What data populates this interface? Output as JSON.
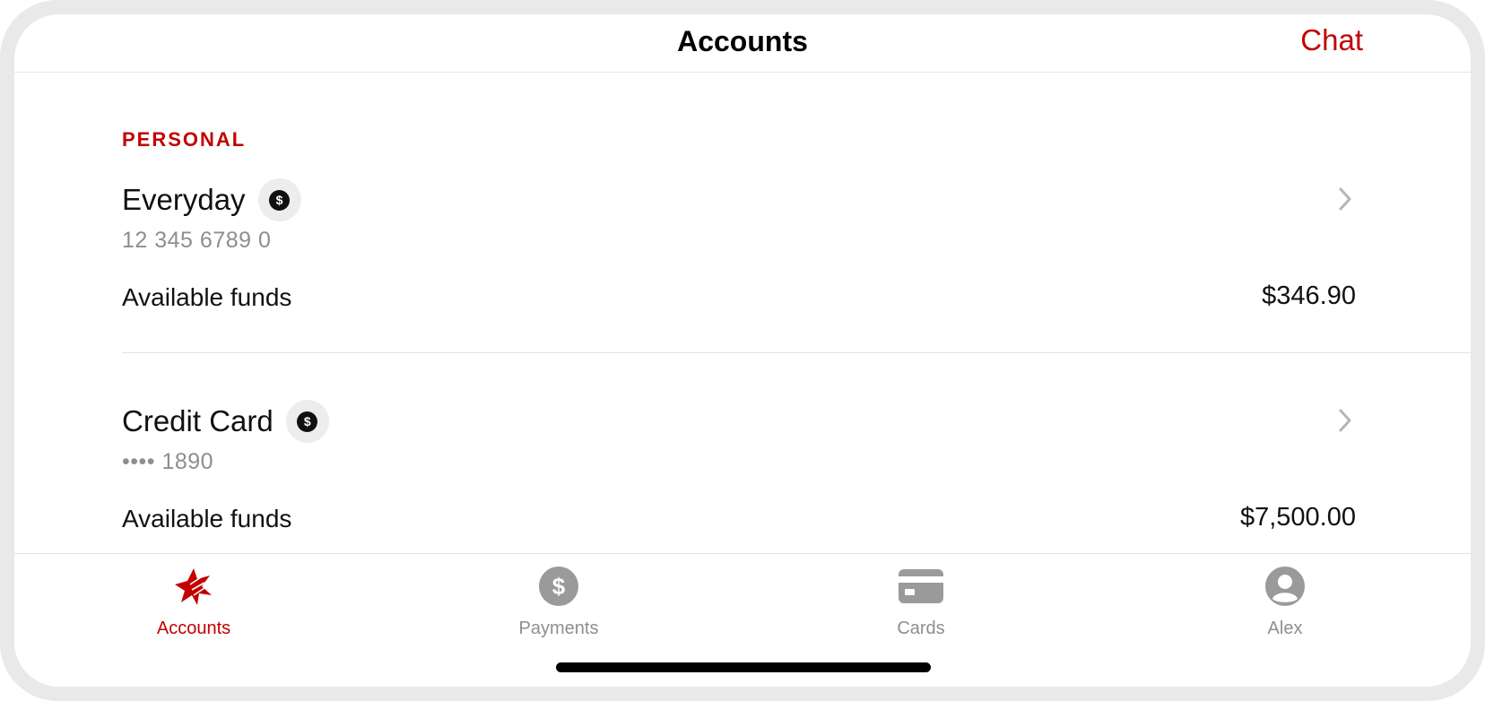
{
  "header": {
    "title": "Accounts",
    "chat_label": "Chat"
  },
  "section": {
    "heading": "PERSONAL"
  },
  "accounts": [
    {
      "name": "Everyday",
      "badge_symbol": "$",
      "number": "12 345 6789 0",
      "funds_label": "Available funds",
      "funds_value": "$346.90"
    },
    {
      "name": "Credit Card",
      "badge_symbol": "$",
      "number": "•••• 1890",
      "funds_label": "Available funds",
      "funds_value": "$7,500.00"
    }
  ],
  "tabbar": {
    "tabs": [
      {
        "label": "Accounts",
        "icon": "star-logo-icon",
        "active": true
      },
      {
        "label": "Payments",
        "icon": "dollar-circle-icon",
        "active": false
      },
      {
        "label": "Cards",
        "icon": "card-icon",
        "active": false
      },
      {
        "label": "Alex",
        "icon": "profile-icon",
        "active": false
      }
    ]
  },
  "colors": {
    "accent": "#c20000",
    "muted": "#8e8e8e",
    "text": "#111111"
  }
}
